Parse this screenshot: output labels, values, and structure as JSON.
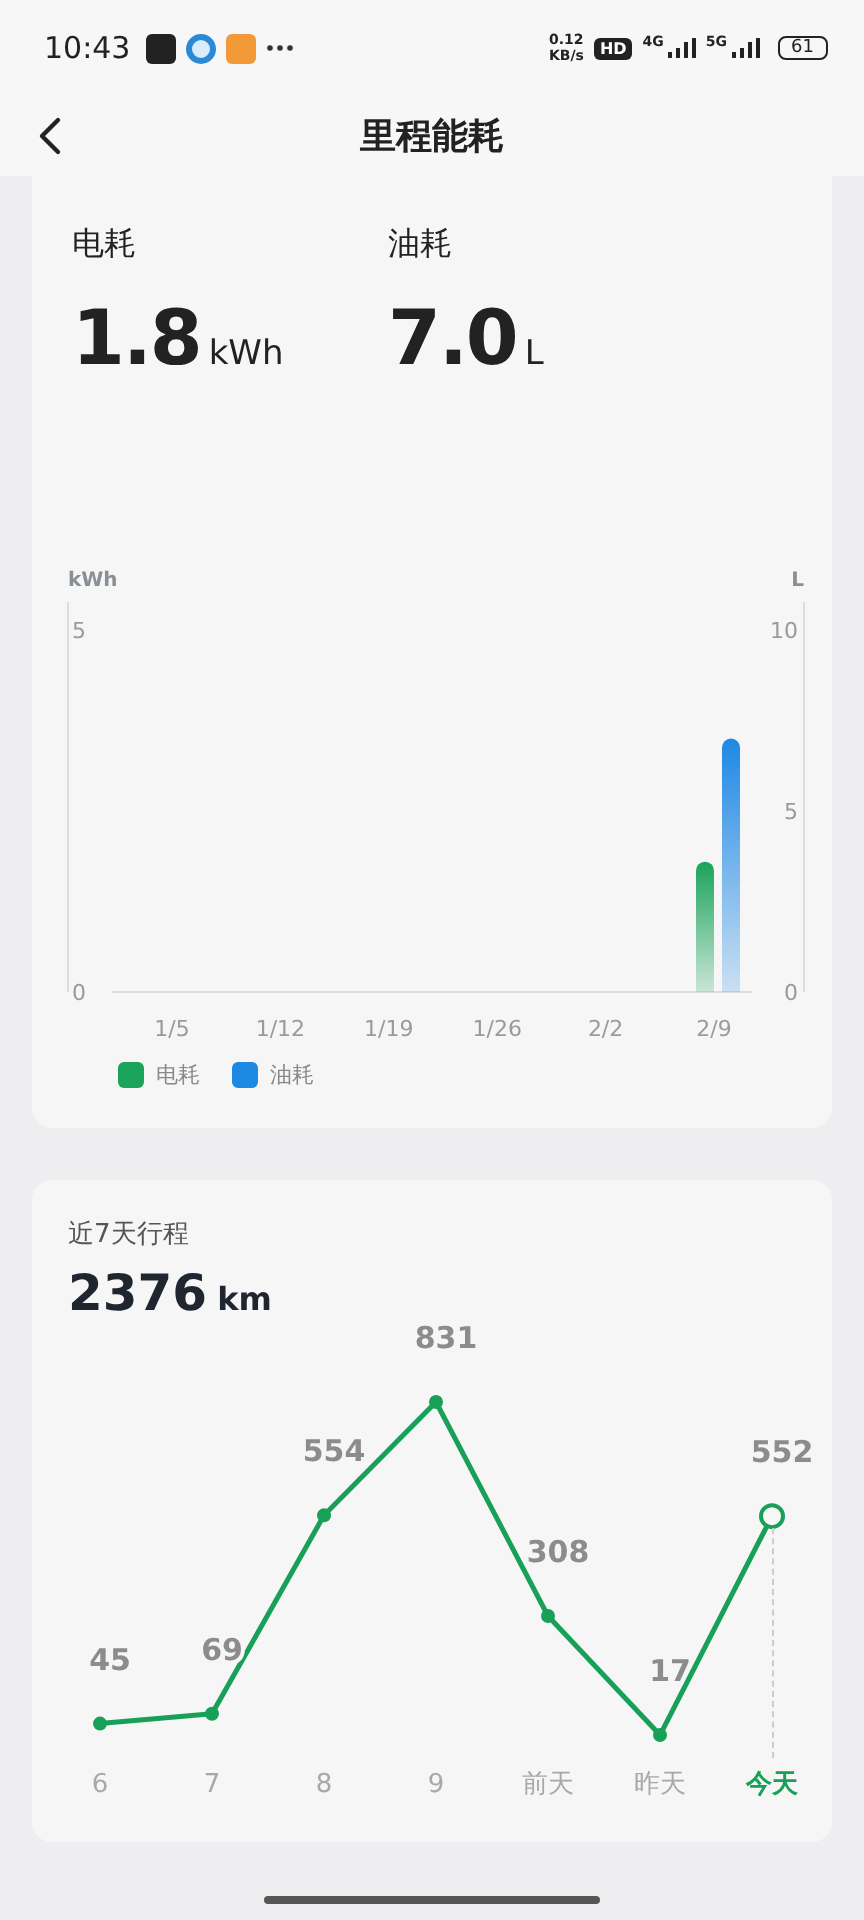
{
  "status_bar": {
    "time": "10:43",
    "speed": "0.12",
    "speed_unit": "KB/s",
    "hd": "HD",
    "networks": [
      "4G",
      "5G"
    ],
    "battery": "61"
  },
  "header": {
    "title": "里程能耗"
  },
  "energy": {
    "stats": [
      {
        "label": "电耗",
        "value": "1.8",
        "unit": "kWh"
      },
      {
        "label": "油耗",
        "value": "7.0",
        "unit": "L"
      }
    ],
    "chart_data": {
      "type": "bar",
      "categories": [
        "1/5",
        "1/12",
        "1/19",
        "1/26",
        "2/2",
        "2/9"
      ],
      "ylabel": "kWh",
      "ylim": [
        0,
        5
      ],
      "yticks": [
        0,
        5
      ],
      "y2label": "L",
      "y2lim": [
        0,
        10
      ],
      "y2ticks": [
        0,
        5,
        10
      ],
      "series": [
        {
          "name": "电耗",
          "color": "#1aa35a",
          "values": [
            0,
            0,
            0,
            0,
            0,
            1.8
          ]
        },
        {
          "name": "油耗",
          "color": "#1e88e5",
          "axis": "y2",
          "values": [
            0,
            0,
            0,
            0,
            0,
            7.0
          ]
        }
      ]
    }
  },
  "trips": {
    "title": "近7天行程",
    "total": "2376",
    "unit": "km",
    "chart_data": {
      "type": "line",
      "categories": [
        "6",
        "7",
        "8",
        "9",
        "前天",
        "昨天",
        "今天"
      ],
      "data_labels": true,
      "series": [
        {
          "color": "#18a058",
          "marker": "o",
          "values": [
            45,
            69,
            554,
            831,
            308,
            17,
            552
          ]
        }
      ]
    }
  }
}
